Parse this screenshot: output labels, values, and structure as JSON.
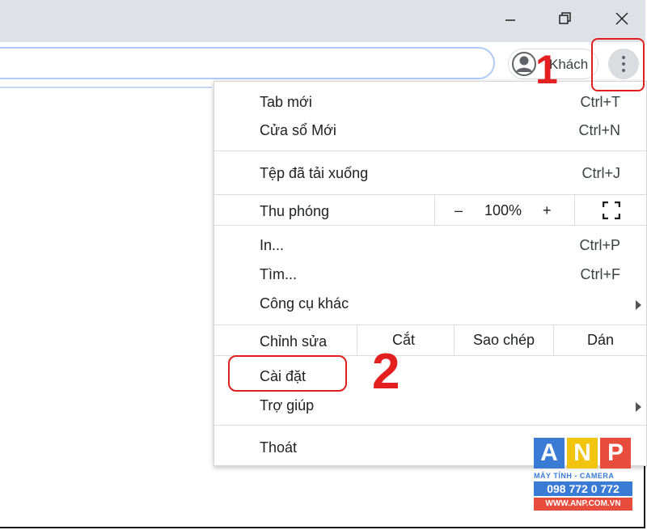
{
  "window": {
    "minimize_icon": "minimize-icon",
    "restore_icon": "restore-icon",
    "close_icon": "close-icon"
  },
  "profile": {
    "name": "Khách",
    "icon": "avatar-icon"
  },
  "menu": {
    "new_tab": {
      "label": "Tab mới",
      "shortcut": "Ctrl+T"
    },
    "new_window": {
      "label": "Cửa sổ Mới",
      "shortcut": "Ctrl+N"
    },
    "downloads": {
      "label": "Tệp đã tải xuống",
      "shortcut": "Ctrl+J"
    },
    "zoom": {
      "label": "Thu phóng",
      "minus": "–",
      "value": "100%",
      "plus": "+"
    },
    "print": {
      "label": "In...",
      "shortcut": "Ctrl+P"
    },
    "find": {
      "label": "Tìm...",
      "shortcut": "Ctrl+F"
    },
    "more_tools": {
      "label": "Công cụ khác"
    },
    "edit": {
      "label": "Chỉnh sửa",
      "cut": "Cắt",
      "copy": "Sao chép",
      "paste": "Dán"
    },
    "settings": {
      "label": "Cài đặt"
    },
    "help": {
      "label": "Trợ giúp"
    },
    "exit": {
      "label": "Thoát"
    }
  },
  "annotations": {
    "step1": "1",
    "step2": "2"
  },
  "watermark": {
    "letters": [
      "A",
      "N",
      "P"
    ],
    "letter_colors": [
      "#3a7bd5",
      "#f1c40f",
      "#e74c3c"
    ],
    "subtitle": "MÁY TÍNH - CAMERA",
    "phone": "098 772 0 772",
    "website": "WWW.ANP.COM.VN"
  },
  "colors": {
    "accent_red": "#e41f1f",
    "titlebar": "#dee1e6",
    "omnibox_border": "#aecbfa"
  }
}
